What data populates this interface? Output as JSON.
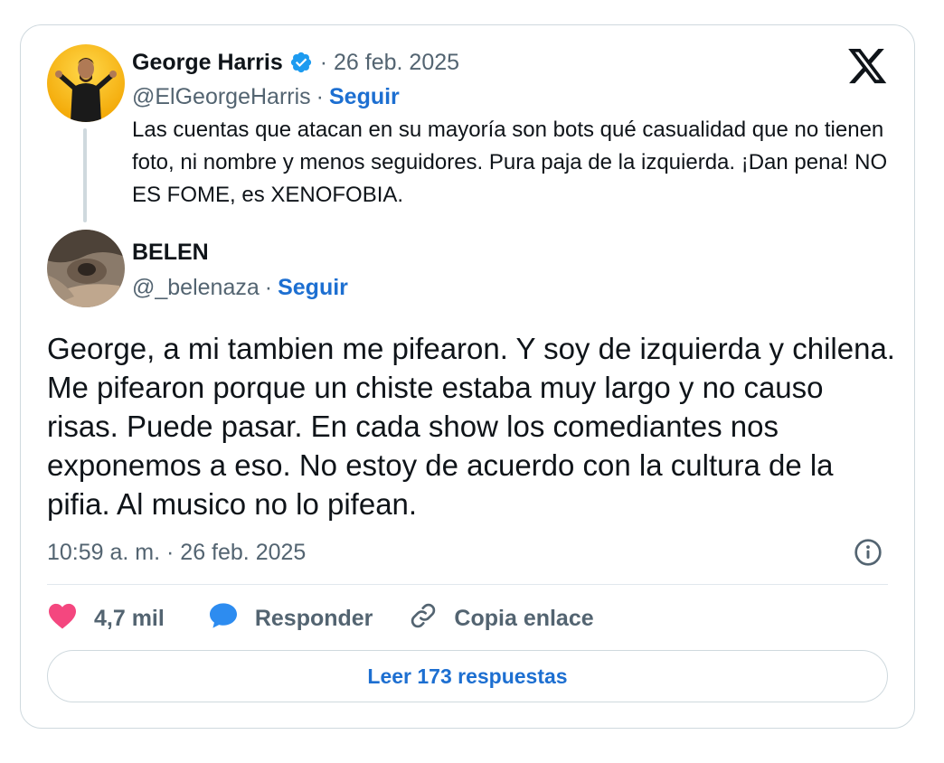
{
  "colors": {
    "link": "#1d6fd1",
    "secondary_text": "#536471",
    "primary_text": "#0f1419",
    "like": "#f4477f",
    "reply": "#2d8cf0",
    "border": "#cfd9de"
  },
  "quoted_tweet": {
    "author_name": "George Harris",
    "verified": true,
    "date": "· 26 feb. 2025",
    "handle": "@ElGeorgeHarris",
    "separator": "·",
    "follow_label": "Seguir",
    "text": "Las cuentas que atacan en su mayoría son bots qué casualidad que no tienen foto, ni nombre y menos seguidores. Pura paja de la izquierda. ¡Dan pena! NO ES FOME, es XENOFOBIA."
  },
  "main_tweet": {
    "author_name": "BELEN",
    "handle": "@_belenaza",
    "separator": "·",
    "follow_label": "Seguir",
    "text": "George, a mi tambien me pifearon. Y soy de izquierda y chilena. Me pifearon porque un chiste estaba muy largo y no causo risas. Puede pasar. En cada show los comediantes nos exponemos a eso. No estoy de acuerdo con la cultura de la pifia. Al musico no lo pifean.",
    "timestamp": "10:59 a. m. · 26 feb. 2025"
  },
  "actions": {
    "likes": "4,7 mil",
    "reply_label": "Responder",
    "copy_link_label": "Copia enlace"
  },
  "read_replies_label": "Leer 173 respuestas",
  "icons": {
    "brand": "x-logo-icon",
    "verified": "verified-badge-icon",
    "info": "info-icon",
    "like": "heart-icon",
    "reply": "speech-bubble-icon",
    "link": "link-icon"
  }
}
